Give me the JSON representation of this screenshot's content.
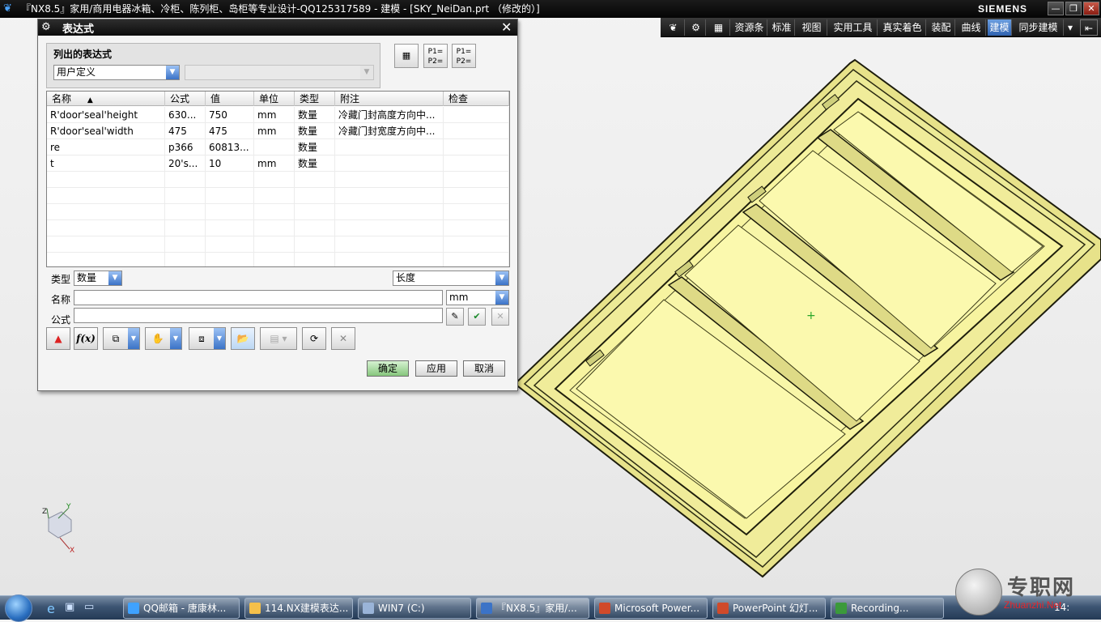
{
  "window": {
    "title": "『NX8.5』家用/商用电器冰箱、冷柜、陈列柜、岛柜等专业设计-QQ125317589 - 建模 - [SKY_NeiDan.prt （修改的）]",
    "brand": "SIEMENS",
    "minimize": "—",
    "restore": "❐",
    "close": "✕"
  },
  "ribbon": {
    "items": [
      "资源条",
      "标准",
      "视图",
      "实用工具",
      "真实着色",
      "装配",
      "曲线",
      "建模",
      "同步建模"
    ],
    "active": "建模"
  },
  "dialog": {
    "title": "表达式",
    "listed_group_label": "列出的表达式",
    "filter_value": "用户定义",
    "table": {
      "columns": [
        "名称",
        "公式",
        "值",
        "单位",
        "类型",
        "附注",
        "检查"
      ],
      "rows": [
        [
          "R'door'seal'height",
          "630...",
          "750",
          "mm",
          "数量",
          "冷藏门封高度方向中...",
          ""
        ],
        [
          "R'door'seal'width",
          "475",
          "475",
          "mm",
          "数量",
          "冷藏门封宽度方向中...",
          ""
        ],
        [
          "re",
          "p366",
          "60813...",
          "",
          "数量",
          "",
          ""
        ],
        [
          "t",
          "20's...",
          "10",
          "mm",
          "数量",
          "",
          ""
        ]
      ]
    },
    "type_label": "类型",
    "type_value": "数量",
    "dimension_value": "长度",
    "name_label": "名称",
    "name_value": "",
    "unit_value": "mm",
    "formula_label": "公式",
    "formula_value": "",
    "buttons": {
      "ok": "确定",
      "apply": "应用",
      "cancel": "取消"
    }
  },
  "taskbar": {
    "items": [
      "QQ邮箱 - 唐康林...",
      "114.NX建模表达...",
      "WIN7 (C:)",
      "『NX8.5』家用/...",
      "Microsoft Power...",
      "PowerPoint 幻灯...",
      "Recording..."
    ],
    "clock": "14:"
  },
  "watermark": {
    "text": "专职网",
    "url": "Zhuanzhi.Net"
  },
  "colors": {
    "part_fill": "#f7f4a0",
    "part_edge": "#2a2a10",
    "accent": "#3b73c7"
  }
}
